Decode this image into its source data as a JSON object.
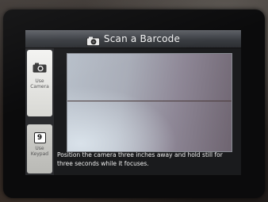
{
  "title_bar": {
    "icon": "camera-icon",
    "title": "Scan a Barcode"
  },
  "sidebar": {
    "camera_button": {
      "icon": "camera-icon",
      "label": "Use Camera"
    },
    "keypad_button": {
      "key": "9",
      "label": "Use Keypad"
    }
  },
  "viewfinder": {
    "instructions": "Position the camera three inches away and hold still for three seconds while it focuses."
  },
  "colors": {
    "title_bar": "#3a3d42",
    "screen_bg": "#1a1b1d",
    "button_bg": "#eeeeec"
  }
}
